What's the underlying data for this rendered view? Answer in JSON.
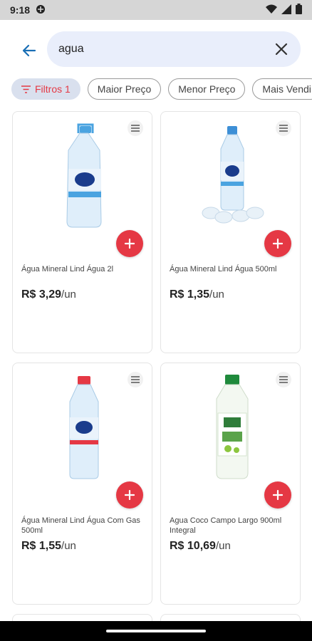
{
  "status": {
    "time": "9:18"
  },
  "search": {
    "value": "agua"
  },
  "chips": [
    {
      "label": "Filtros 1"
    },
    {
      "label": "Maior Preço"
    },
    {
      "label": "Menor Preço"
    },
    {
      "label": "Mais Vendi"
    }
  ],
  "products": [
    {
      "name": "Água Mineral Lind Água 2l",
      "price": "R$ 3,29",
      "unit": "/un",
      "cap": "#4aa3e0"
    },
    {
      "name": "Água Mineral Lind Água 500ml",
      "price": "R$ 1,35",
      "unit": "/un",
      "cap": "#3d8fd6"
    },
    {
      "name": "Água Mineral Lind Água Com Gas 500ml",
      "price": "R$ 1,55",
      "unit": "/un",
      "cap": "#e53844"
    },
    {
      "name": "Agua Coco Campo Largo 900ml Integral",
      "price": "R$ 10,69",
      "unit": "/un",
      "cap": "#1f8a3c"
    }
  ],
  "colors": {
    "accent": "#e53844",
    "search_bg": "#e9eefb",
    "chip_active_bg": "#d9e0ee"
  }
}
